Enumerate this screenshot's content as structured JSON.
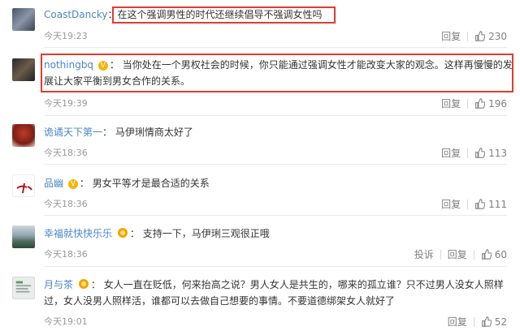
{
  "comments": [
    {
      "user": "CoastDancky",
      "text": "在这个强调男性的时代还继续倡导不强调女性吗",
      "time": "今天19:23",
      "reply": "回复",
      "likes": "230"
    },
    {
      "user": "nothingbq",
      "badge": "V",
      "text_line1": "当你处在一个男权社会的时候，你只能通过强调女性才能改变大家的观念。这样再慢慢的发",
      "text_line2": "展让大家平衡到男女合作的关系。",
      "time": "今天19:39",
      "reply": "回复",
      "likes": "196"
    },
    {
      "user": "诡谲天下第一",
      "text": "马伊琍情商太好了",
      "time": "今天18:36",
      "reply": "回复",
      "likes": "113"
    },
    {
      "user": "品幽",
      "badge": "V",
      "text": "男女平等才是最合适的关系",
      "time": "今天18:36",
      "reply": "回复",
      "likes": "111"
    },
    {
      "user": "幸福就快快乐乐",
      "text": "支持一下，马伊琍三观很正哦",
      "time": "今天18:36",
      "report": "投诉",
      "reply": "回复",
      "likes": "60"
    },
    {
      "user": "月与茶",
      "text_line1": "女人一直在贬低，何来抬高之说？男人女人是共生的，哪来的孤立谁？只不过男人没女人照样",
      "text_line2": "过，女人没男人照样活，谁都可以去做自己想要的事情。不要道德绑架女人就好了",
      "time": "今天19:01",
      "reply": "回复",
      "likes": "52"
    }
  ],
  "colors": {
    "username_orange": "#eb7350",
    "highlight_red": "#e03c31"
  }
}
